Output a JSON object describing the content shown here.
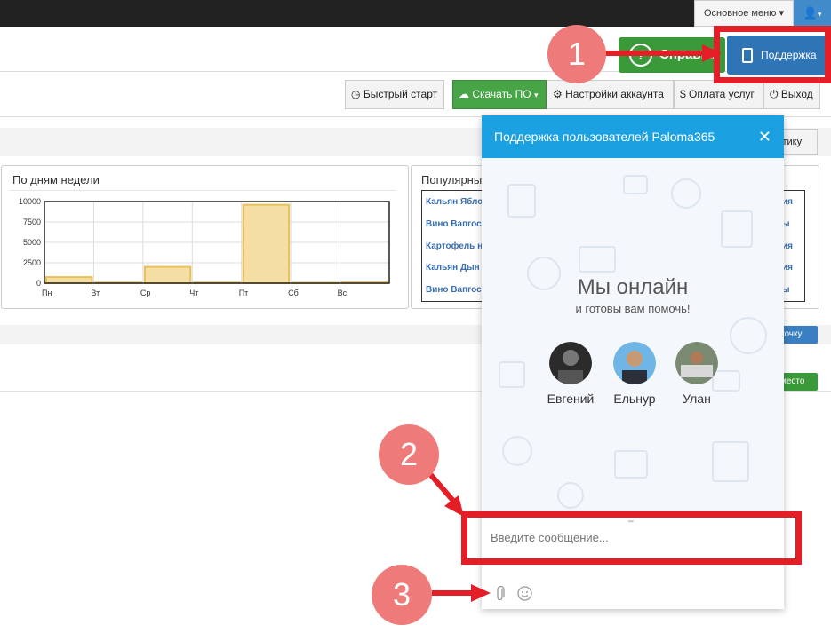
{
  "header": {
    "main_menu_label": "Основное меню",
    "help_label": "Справка",
    "support_label": "Поддержка"
  },
  "toolbar": {
    "quick_start": "Быстрый старт",
    "download": "Скачать ПО",
    "account_settings": "Настройки аккаунта",
    "payment": "Оплата услуг",
    "logout": "Выход"
  },
  "stats_button_fragment": "стику",
  "weekday_panel": {
    "title": "По дням недели"
  },
  "popular_panel": {
    "title": "Популярные",
    "items": [
      "Кальян Ябло",
      "Вино Вапгос",
      "Картофель н",
      "Кальян Дын",
      "Вино Вапгос"
    ],
    "right_fragments": [
      "ия",
      "ы",
      "ия",
      "ия",
      "ы"
    ]
  },
  "card_button_fragment": "точку",
  "place_button_fragment": "место",
  "chart_data": {
    "type": "bar",
    "title": "По дням недели",
    "categories": [
      "Пн",
      "Вт",
      "Ср",
      "Чт",
      "Пт",
      "Сб",
      "Вс"
    ],
    "values": [
      750,
      80,
      2000,
      80,
      9600,
      50,
      100
    ],
    "ylim": [
      0,
      10000
    ],
    "yticks": [
      0,
      2500,
      5000,
      7500,
      10000
    ],
    "color": "#f5dea4",
    "edge_color": "#e8c05a",
    "grid": true
  },
  "chat": {
    "title": "Поддержка пользователей Paloma365",
    "close_symbol": "✕",
    "online_title": "Мы онлайн",
    "online_sub": "и готовы вам помочь!",
    "agents": [
      {
        "name": "Евгений"
      },
      {
        "name": "Ельнур"
      },
      {
        "name": "Улан"
      }
    ],
    "input_placeholder": "Введите сообщение..."
  },
  "annotations": {
    "badge1": "1",
    "badge2": "2",
    "badge3": "3",
    "color": "#e41e26",
    "badge_color": "#ef7a7a"
  }
}
